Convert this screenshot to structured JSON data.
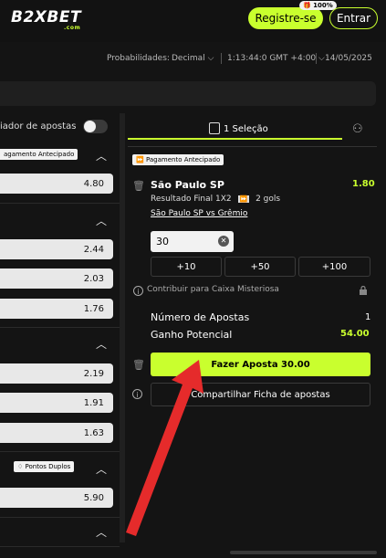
{
  "header": {
    "logo": "B2XBET",
    "logo_sub": ".com",
    "promo_badge": "100%",
    "register_label": "Registre-se",
    "enter_label": "Entrar"
  },
  "settings_bar": {
    "odds_format_label": "Probabilidades:",
    "odds_format_value": "Decimal",
    "time": "1:13:44:0 GMT +4:00",
    "date": "14/05/2025"
  },
  "left_panel": {
    "toggle_label": "iador de apostas",
    "early_payout_badge": "agamento Antecipado",
    "double_points_badge": "Pontos Duplos",
    "odds": [
      "4.80",
      "2.44",
      "2.03",
      "1.76",
      "2.19",
      "1.91",
      "1.63",
      "5.90"
    ]
  },
  "betslip": {
    "tab_label": "1 Seleção",
    "early_payout_badge": "Pagamento Antecipado",
    "team": "São Paulo SP",
    "odds": "1.80",
    "market": "Resultado Final 1X2",
    "goals": "2 gols",
    "match": "São Paulo SP vs Grêmio",
    "stake": "30",
    "quick_amounts": [
      "+10",
      "+50",
      "+100"
    ],
    "mystery_box_label": "Contribuir para Caixa Misteriosa",
    "num_bets_label": "Número de Apostas",
    "num_bets_value": "1",
    "potential_win_label": "Ganho Potencial",
    "potential_win_value": "54.00",
    "place_bet_label": "Fazer Aposta 30.00",
    "share_label": "Compartilhar Ficha de apostas"
  },
  "colors": {
    "accent": "#c9ff2e",
    "arrow": "#e52b2b",
    "background": "#141414"
  }
}
